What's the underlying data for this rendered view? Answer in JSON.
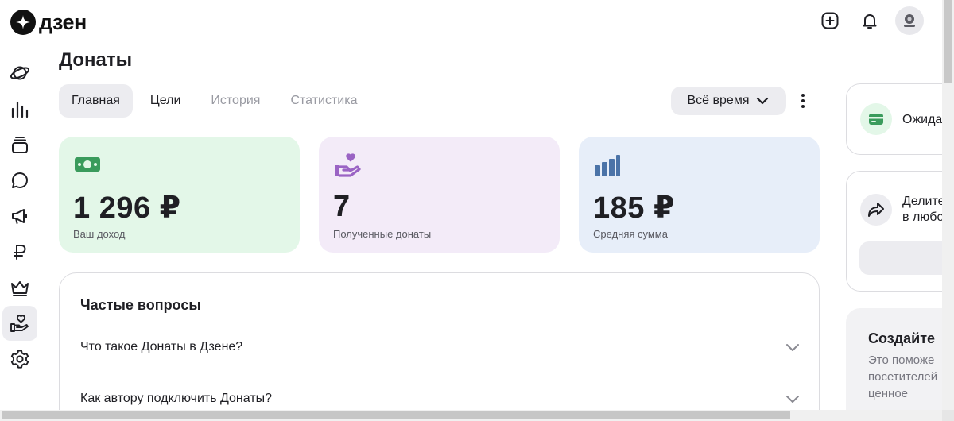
{
  "header": {
    "logo_text": "дзен",
    "logo_icon": "zen-star-icon",
    "actions": [
      "add-icon",
      "bell-icon",
      "avatar"
    ]
  },
  "sidebar": {
    "items": [
      {
        "icon": "planet-icon"
      },
      {
        "icon": "stats-icon"
      },
      {
        "icon": "stack-icon"
      },
      {
        "icon": "chat-icon"
      },
      {
        "icon": "megaphone-icon"
      },
      {
        "icon": "ruble-icon"
      },
      {
        "icon": "crown-icon"
      },
      {
        "icon": "donate-hand-icon",
        "active": true
      },
      {
        "icon": "gear-icon"
      }
    ]
  },
  "page": {
    "title": "Донаты",
    "tabs": [
      {
        "label": "Главная",
        "active": true
      },
      {
        "label": "Цели"
      },
      {
        "label": "История"
      },
      {
        "label": "Статистика"
      }
    ],
    "period": {
      "value": "Всё время"
    }
  },
  "stats": [
    {
      "value": "1 296 ₽",
      "label": "Ваш доход",
      "color": "#e3f7e8",
      "icon": "money-icon"
    },
    {
      "value": "7",
      "label": "Полученные донаты",
      "color": "#f3ebf8",
      "icon": "heart-hand-icon"
    },
    {
      "value": "185 ₽",
      "label": "Средняя сумма",
      "color": "#e7eef9",
      "icon": "bars-icon"
    }
  ],
  "faq": {
    "title": "Частые вопросы",
    "items": [
      {
        "question": "Что такое Донаты в Дзене?"
      },
      {
        "question": "Как автору подключить Донаты?"
      }
    ]
  },
  "right_panel": {
    "card1_text": "Ожида",
    "card2_line1": "Делите",
    "card2_line2": "в любо",
    "card3_title": "Создайте",
    "card3_line1": "Это поможе",
    "card3_line2": "посетителей",
    "card3_line3": "ценное"
  },
  "colors": {
    "accent_green": "#3a9b5c",
    "accent_purple": "#9a63c4",
    "accent_blue": "#4b73a8"
  }
}
